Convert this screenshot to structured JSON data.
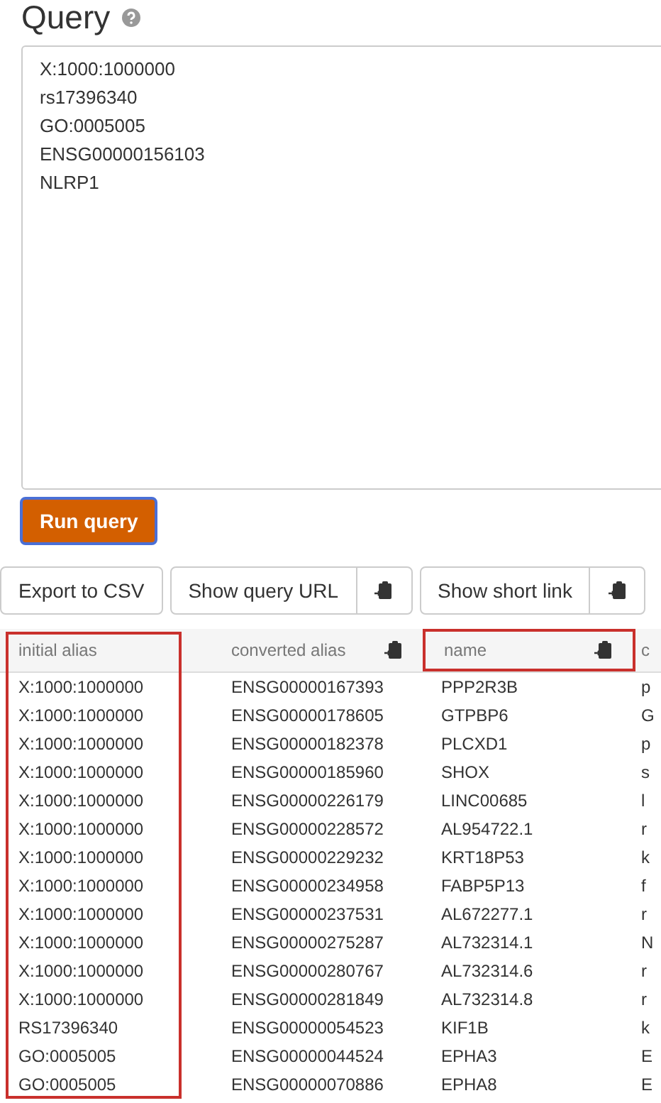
{
  "title": "Query",
  "query": {
    "value": "X:1000:1000000\nrs17396340\nGO:0005005\nENSG00000156103\nNLRP1"
  },
  "run_button": {
    "label": "Run query",
    "focused": true
  },
  "actions": [
    {
      "label": "Export to CSV",
      "kind": "plain"
    },
    {
      "label": "Show query URL",
      "kind": "copy"
    },
    {
      "label": "Show short link",
      "kind": "copy"
    }
  ],
  "table": {
    "columns": [
      {
        "label": "initial alias",
        "copy": false,
        "header_boxed": false,
        "column_boxed": true
      },
      {
        "label": "converted alias",
        "copy": true,
        "header_boxed": false,
        "column_boxed": false
      },
      {
        "label": "name",
        "copy": true,
        "header_boxed": true,
        "column_boxed": false
      },
      {
        "label": "c",
        "copy": false,
        "header_boxed": false,
        "column_boxed": false
      }
    ],
    "rows": [
      [
        "X:1000:1000000",
        "ENSG00000167393",
        "PPP2R3B",
        "p"
      ],
      [
        "X:1000:1000000",
        "ENSG00000178605",
        "GTPBP6",
        "G"
      ],
      [
        "X:1000:1000000",
        "ENSG00000182378",
        "PLCXD1",
        "p"
      ],
      [
        "X:1000:1000000",
        "ENSG00000185960",
        "SHOX",
        "s"
      ],
      [
        "X:1000:1000000",
        "ENSG00000226179",
        "LINC00685",
        "l"
      ],
      [
        "X:1000:1000000",
        "ENSG00000228572",
        "AL954722.1",
        "r"
      ],
      [
        "X:1000:1000000",
        "ENSG00000229232",
        "KRT18P53",
        "k"
      ],
      [
        "X:1000:1000000",
        "ENSG00000234958",
        "FABP5P13",
        "f"
      ],
      [
        "X:1000:1000000",
        "ENSG00000237531",
        "AL672277.1",
        "r"
      ],
      [
        "X:1000:1000000",
        "ENSG00000275287",
        "AL732314.1",
        "N"
      ],
      [
        "X:1000:1000000",
        "ENSG00000280767",
        "AL732314.6",
        "r"
      ],
      [
        "X:1000:1000000",
        "ENSG00000281849",
        "AL732314.8",
        "r"
      ],
      [
        "RS17396340",
        "ENSG00000054523",
        "KIF1B",
        "k"
      ],
      [
        "GO:0005005",
        "ENSG00000044524",
        "EPHA3",
        "E"
      ],
      [
        "GO:0005005",
        "ENSG00000070886",
        "EPHA8",
        "E"
      ]
    ]
  }
}
